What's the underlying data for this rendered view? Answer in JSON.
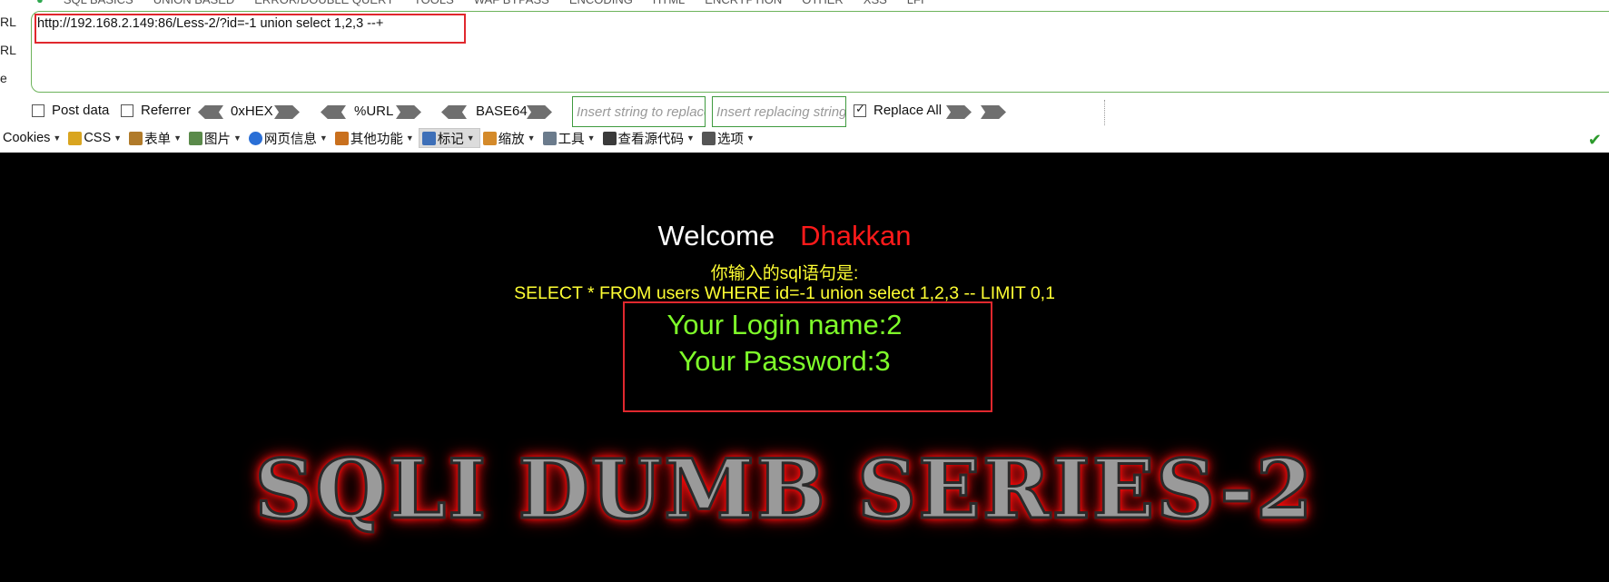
{
  "hackbar": {
    "top_menu": [
      "SQL BASICS",
      "UNION BASED",
      "ERROR/DOUBLE QUERY",
      "TOOLS",
      "WAF BYPASS",
      "ENCODING",
      "HTML",
      "ENCRYPTION",
      "OTHER",
      "XSS",
      "LFI"
    ],
    "side_labels": [
      "RL",
      "RL",
      "e"
    ],
    "url_value": "http://192.168.2.149:86/Less-2/?id=-1 union select 1,2,3 --+",
    "post_data_label": "Post data",
    "referrer_label": "Referrer",
    "hex_label": "0xHEX",
    "url_enc_label": "%URL",
    "base64_label": "BASE64",
    "replace_placeholder": "Insert string to replace",
    "replacing_placeholder": "Insert replacing string",
    "replace_all_label": "Replace All",
    "replace_all_checked": true
  },
  "toolbar": {
    "items": [
      {
        "label": "Cookies",
        "icon": "cookies-icon"
      },
      {
        "label": "CSS",
        "icon": "css-wand-icon"
      },
      {
        "label": "表单",
        "icon": "form-clipboard-icon"
      },
      {
        "label": "图片",
        "icon": "image-icon"
      },
      {
        "label": "网页信息",
        "icon": "info-icon"
      },
      {
        "label": "其他功能",
        "icon": "book-icon"
      },
      {
        "label": "标记",
        "icon": "pencil-icon"
      },
      {
        "label": "缩放",
        "icon": "ruler-icon"
      },
      {
        "label": "工具",
        "icon": "tools-icon"
      },
      {
        "label": "查看源代码",
        "icon": "source-code-icon"
      },
      {
        "label": "选项",
        "icon": "options-icon"
      }
    ],
    "active_item": "标记",
    "status_icon": "green-check-icon"
  },
  "page": {
    "welcome_label": "Welcome",
    "welcome_name": "Dhakkan",
    "sql_label": "你输入的sql语句是:",
    "sql_query": "SELECT * FROM users WHERE id=-1 union select 1,2,3 -- LIMIT 0,1",
    "login_name": "Your Login name:2",
    "password": "Your Password:3",
    "banner": "SQLI DUMB SERIES-2"
  },
  "colors": {
    "page_bg": "#000000",
    "welcome": "#ffffff",
    "name": "#ff1a1a",
    "sql_text": "#ffff33",
    "result_text": "#7fff2a",
    "highlight_box": "#e0282e",
    "input_border": "#6db35b"
  }
}
